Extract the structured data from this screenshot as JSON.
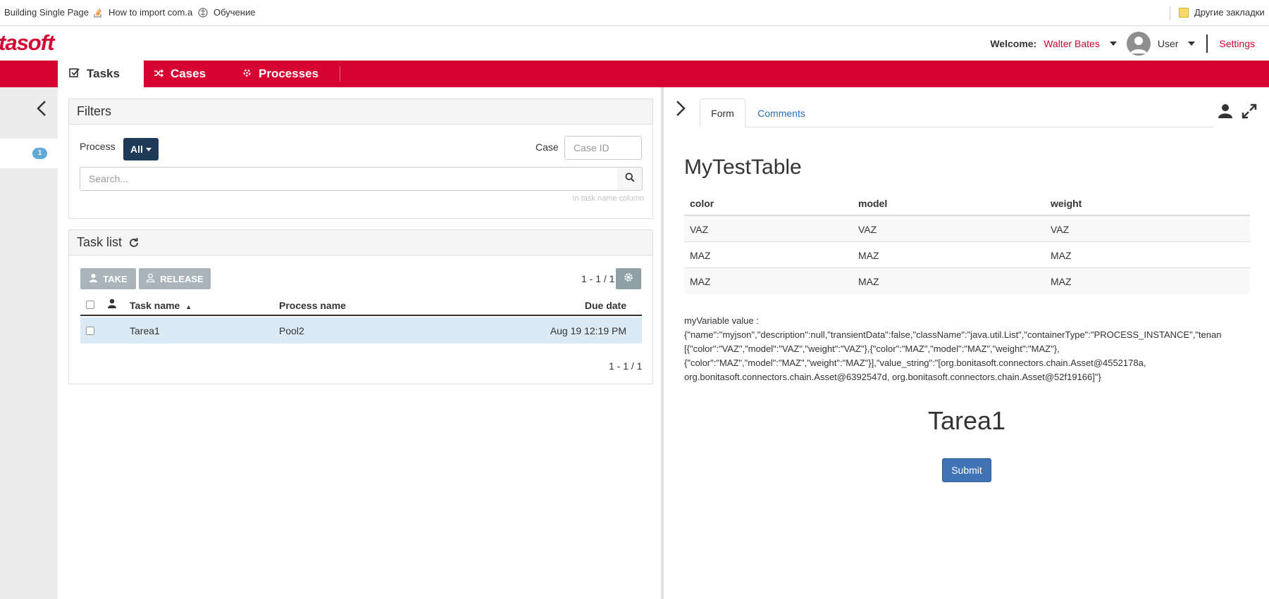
{
  "bookmarks": {
    "items": [
      {
        "label": "Building Single Page"
      },
      {
        "label": "How to import com.a"
      },
      {
        "label": "Обучение"
      }
    ],
    "other": "Другие закладки"
  },
  "header": {
    "logo_dark": "",
    "logo_red": "",
    "logo_text": "tasoft",
    "welcome": "Welcome:",
    "user_name": "Walter Bates",
    "profile": "User",
    "settings": "Settings"
  },
  "nav": {
    "tabs": [
      {
        "label": "Tasks",
        "icon": "check-square-icon"
      },
      {
        "label": "Cases",
        "icon": "shuffle-icon"
      },
      {
        "label": "Processes",
        "icon": "gears-icon"
      }
    ]
  },
  "sidebar": {
    "badge": "1"
  },
  "filters": {
    "title": "Filters",
    "process_label": "Process",
    "process_value": "All",
    "case_label": "Case",
    "case_placeholder": "Case ID",
    "search_placeholder": "Search...",
    "search_hint": "In task name column"
  },
  "tasklist": {
    "title": "Task list",
    "take": "TAKE",
    "release": "RELEASE",
    "count_top": "1 - 1 / 1",
    "count_bottom": "1 - 1 / 1",
    "columns": {
      "task": "Task name",
      "process": "Process name",
      "due": "Due date"
    },
    "rows": [
      {
        "task": "Tarea1",
        "process": "Pool2",
        "due": "Aug 19 12:19 PM"
      }
    ]
  },
  "detail": {
    "tabs": {
      "form": "Form",
      "comments": "Comments"
    },
    "form_title": "MyTestTable",
    "table": {
      "headers": [
        "color",
        "model",
        "weight"
      ],
      "rows": [
        [
          "VAZ",
          "VAZ",
          "VAZ"
        ],
        [
          "MAZ",
          "MAZ",
          "MAZ"
        ],
        [
          "MAZ",
          "MAZ",
          "MAZ"
        ]
      ]
    },
    "json_lines": [
      "myVariable value :",
      "{\"name\":\"myjson\",\"description\":null,\"transientData\":false,\"className\":\"java.util.List\",\"containerType\":\"PROCESS_INSTANCE\",\"tenan",
      "[{\"color\":\"VAZ\",\"model\":\"VAZ\",\"weight\":\"VAZ\"},{\"color\":\"MAZ\",\"model\":\"MAZ\",\"weight\":\"MAZ\"},",
      "{\"color\":\"MAZ\",\"model\":\"MAZ\",\"weight\":\"MAZ\"}],\"value_string\":\"[org.bonitasoft.connectors.chain.Asset@4552178a,",
      "org.bonitasoft.connectors.chain.Asset@6392547d, org.bonitasoft.connectors.chain.Asset@52f19166]\"}"
    ],
    "task_title": "Tarea1",
    "submit": "Submit"
  },
  "colors": {
    "brand_red": "#d40331",
    "dark_btn": "#1f3a56",
    "submit_blue": "#3f73b5",
    "row_selected": "#dbeaf5"
  }
}
